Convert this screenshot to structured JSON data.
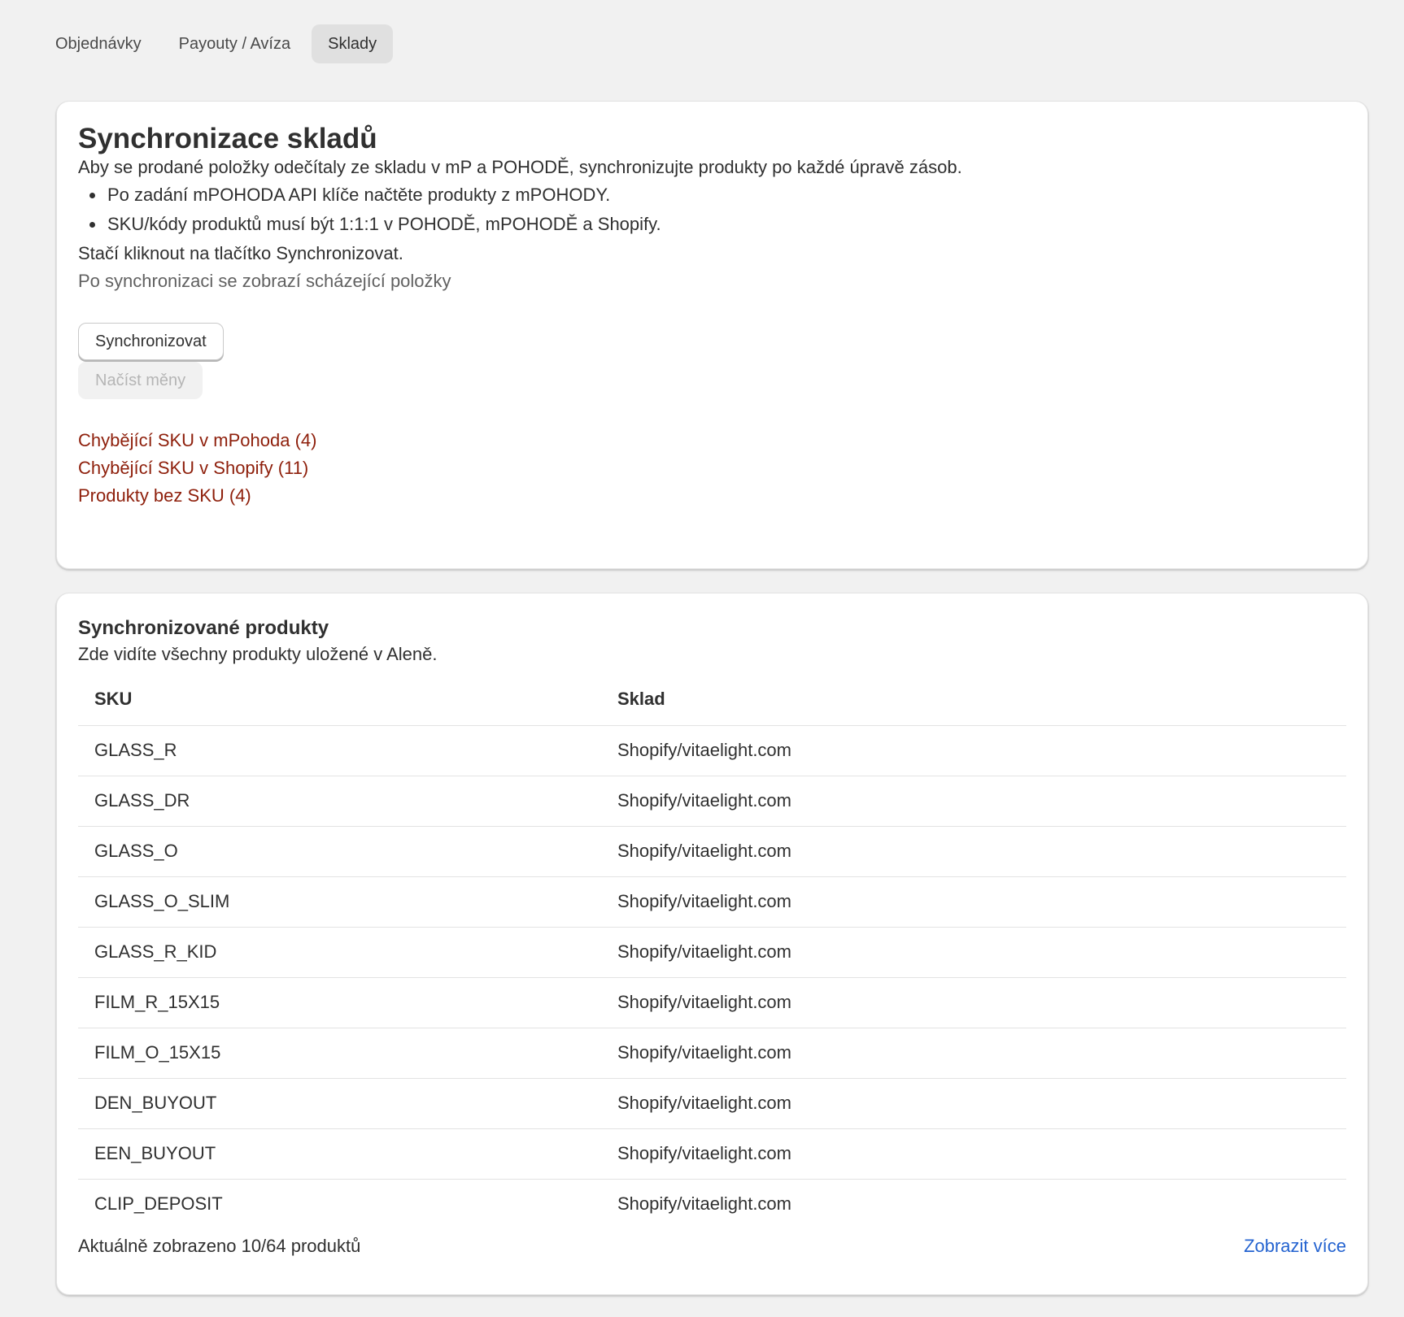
{
  "tabs": [
    {
      "label": "Objednávky",
      "active": false
    },
    {
      "label": "Payouty / Avíza",
      "active": false
    },
    {
      "label": "Sklady",
      "active": true
    }
  ],
  "sync": {
    "title": "Synchronizace skladů",
    "intro": "Aby se prodané položky odečítaly ze skladu v mP a POHODĚ, synchronizujte produkty po každé úpravě zásob.",
    "bullets": [
      "Po zadání mPOHODA API klíče načtěte produkty z mPOHODY.",
      "SKU/kódy produktů musí být 1:1:1 v POHODĚ, mPOHODĚ a Shopify."
    ],
    "hint": "Stačí kliknout na tlačítko Synchronizovat.",
    "note": "Po synchronizaci se zobrazí scházející položky",
    "sync_button": "Synchronizovat",
    "currency_button": "Načíst měny",
    "missing_links": [
      "Chybějící SKU v mPohoda (4)",
      "Chybějící SKU v Shopify (11)",
      "Produkty bez SKU (4)"
    ]
  },
  "products": {
    "title": "Synchronizované produkty",
    "subtitle": "Zde vidíte všechny produkty uložené v Aleně.",
    "columns": {
      "sku": "SKU",
      "warehouse": "Sklad"
    },
    "rows": [
      {
        "sku": "GLASS_R",
        "warehouse": "Shopify/vitaelight.com"
      },
      {
        "sku": "GLASS_DR",
        "warehouse": "Shopify/vitaelight.com"
      },
      {
        "sku": "GLASS_O",
        "warehouse": "Shopify/vitaelight.com"
      },
      {
        "sku": "GLASS_O_SLIM",
        "warehouse": "Shopify/vitaelight.com"
      },
      {
        "sku": "GLASS_R_KID",
        "warehouse": "Shopify/vitaelight.com"
      },
      {
        "sku": "FILM_R_15X15",
        "warehouse": "Shopify/vitaelight.com"
      },
      {
        "sku": "FILM_O_15X15",
        "warehouse": "Shopify/vitaelight.com"
      },
      {
        "sku": "DEN_BUYOUT",
        "warehouse": "Shopify/vitaelight.com"
      },
      {
        "sku": "EEN_BUYOUT",
        "warehouse": "Shopify/vitaelight.com"
      },
      {
        "sku": "CLIP_DEPOSIT",
        "warehouse": "Shopify/vitaelight.com"
      }
    ],
    "count_text": "Aktuálně zobrazeno 10/64 produktů",
    "show_more": "Zobrazit více"
  },
  "colors": {
    "background": "#f1f1f1",
    "critical_link": "#8e1f0b",
    "blue_link": "#2463d0"
  }
}
